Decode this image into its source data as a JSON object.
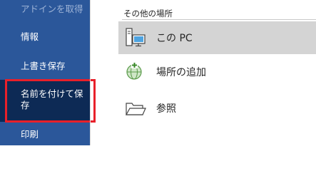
{
  "sidebar": {
    "items": [
      {
        "label": "アドインを取得"
      },
      {
        "label": "情報"
      },
      {
        "label": "上書き保存"
      },
      {
        "label": "名前を付けて保存"
      },
      {
        "label": "印刷"
      }
    ]
  },
  "places": {
    "header": "その他の場所",
    "items": [
      {
        "label": "この PC",
        "icon": "computer-icon"
      },
      {
        "label": "場所の追加",
        "icon": "globe-add-icon"
      },
      {
        "label": "参照",
        "icon": "folder-icon"
      }
    ]
  },
  "colors": {
    "sidebar_bg": "#2b579a",
    "sidebar_selected": "#0d2a55",
    "highlight": "#e8202a",
    "place_selected_bg": "#d4d4d4"
  }
}
